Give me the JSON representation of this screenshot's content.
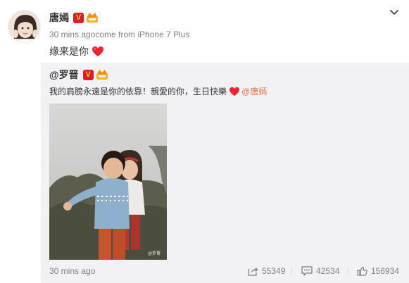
{
  "post": {
    "author": "唐嫣",
    "verified_badge": "V",
    "time_and_source": "30 mins agocome from iPhone 7 Plus",
    "text": "缘来是你"
  },
  "repost": {
    "author_mention": "@罗晋",
    "verified_badge": "V",
    "text": "我的肩膀永遠是你的依靠！親愛的你，生日快樂",
    "mention": "@唐嫣",
    "time_label": "30 mins ago",
    "actions": {
      "forward_count": "55349",
      "comment_count": "42534",
      "like_count": "156934"
    }
  },
  "colors": {
    "accent": "#eb7350",
    "verified_red": "#e6162d",
    "heart_red": "#e8262d",
    "repost_bg": "#f2f2f5"
  },
  "icons": [
    "chevron-down-icon",
    "verified-icon",
    "member-crown-icon",
    "heart-icon",
    "forward-icon",
    "comment-icon",
    "like-icon"
  ]
}
